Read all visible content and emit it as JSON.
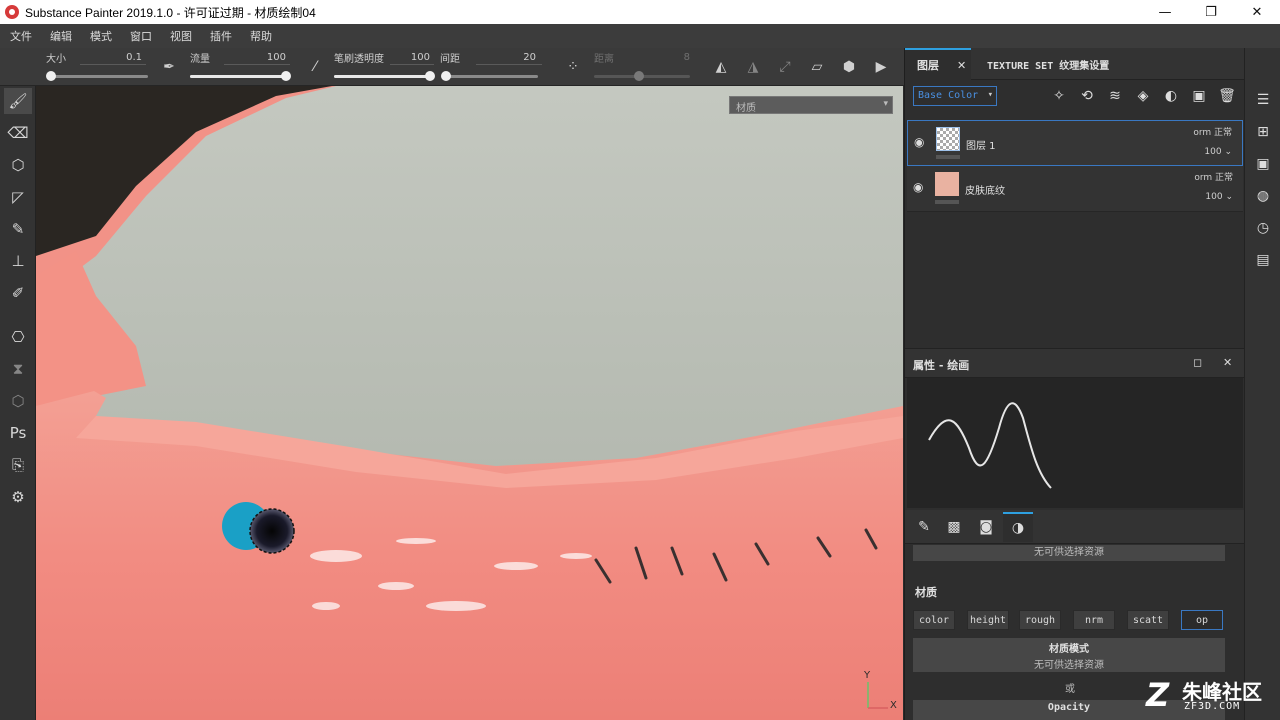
{
  "window": {
    "title": "Substance Painter 2019.1.0 - 许可证过期 - 材质绘制04",
    "minimize": "—",
    "maximize": "❐",
    "close": "✕"
  },
  "menu": [
    "文件",
    "编辑",
    "模式",
    "窗口",
    "视图",
    "插件",
    "帮助"
  ],
  "toolbar": {
    "size_label": "大小",
    "size_value": "0.1",
    "flow_label": "流量",
    "flow_value": "100",
    "stroke_opacity_label": "笔刷透明度",
    "stroke_opacity_value": "100",
    "spacing_label": "间距",
    "spacing_value": "20",
    "distance_label": "距离",
    "distance_value": "8",
    "flow_fill": 1.0,
    "stroke_opacity_fill": 1.0,
    "spacing_fill": 0.04
  },
  "viewport": {
    "material_select": "材质",
    "axis_y": "Y",
    "axis_x": "X",
    "colors": {
      "background": "#c8cbc3",
      "skin": "#f28a80",
      "skin_light": "#f6a196",
      "cursor_fill": "#1aa0c6"
    }
  },
  "layers_panel": {
    "tab_layers": "图层",
    "tab_close": "✕",
    "tab_textureset": "TEXTURE SET 纹理集设置",
    "channel_select": "Base Color",
    "layers": [
      {
        "name": "图层 1",
        "blend": "orm 正常",
        "opacity": "100",
        "thumb": "checker"
      },
      {
        "name": "皮肤底纹",
        "blend": "orm 正常",
        "opacity": "100",
        "thumb": "skin"
      }
    ]
  },
  "properties": {
    "title": "属性 - 绘画",
    "resource_none": "无可供选择资源",
    "material_title": "材质",
    "material_buttons": [
      "color",
      "height",
      "rough",
      "nrm",
      "scatt",
      "op"
    ],
    "material_mode_label": "材质模式",
    "material_mode_value": "无可供选择资源",
    "or_text": "或",
    "opacity_label": "Opacity"
  },
  "watermark": {
    "logo": "Z",
    "name": "朱峰社区",
    "url": "ZF3D.COM"
  }
}
